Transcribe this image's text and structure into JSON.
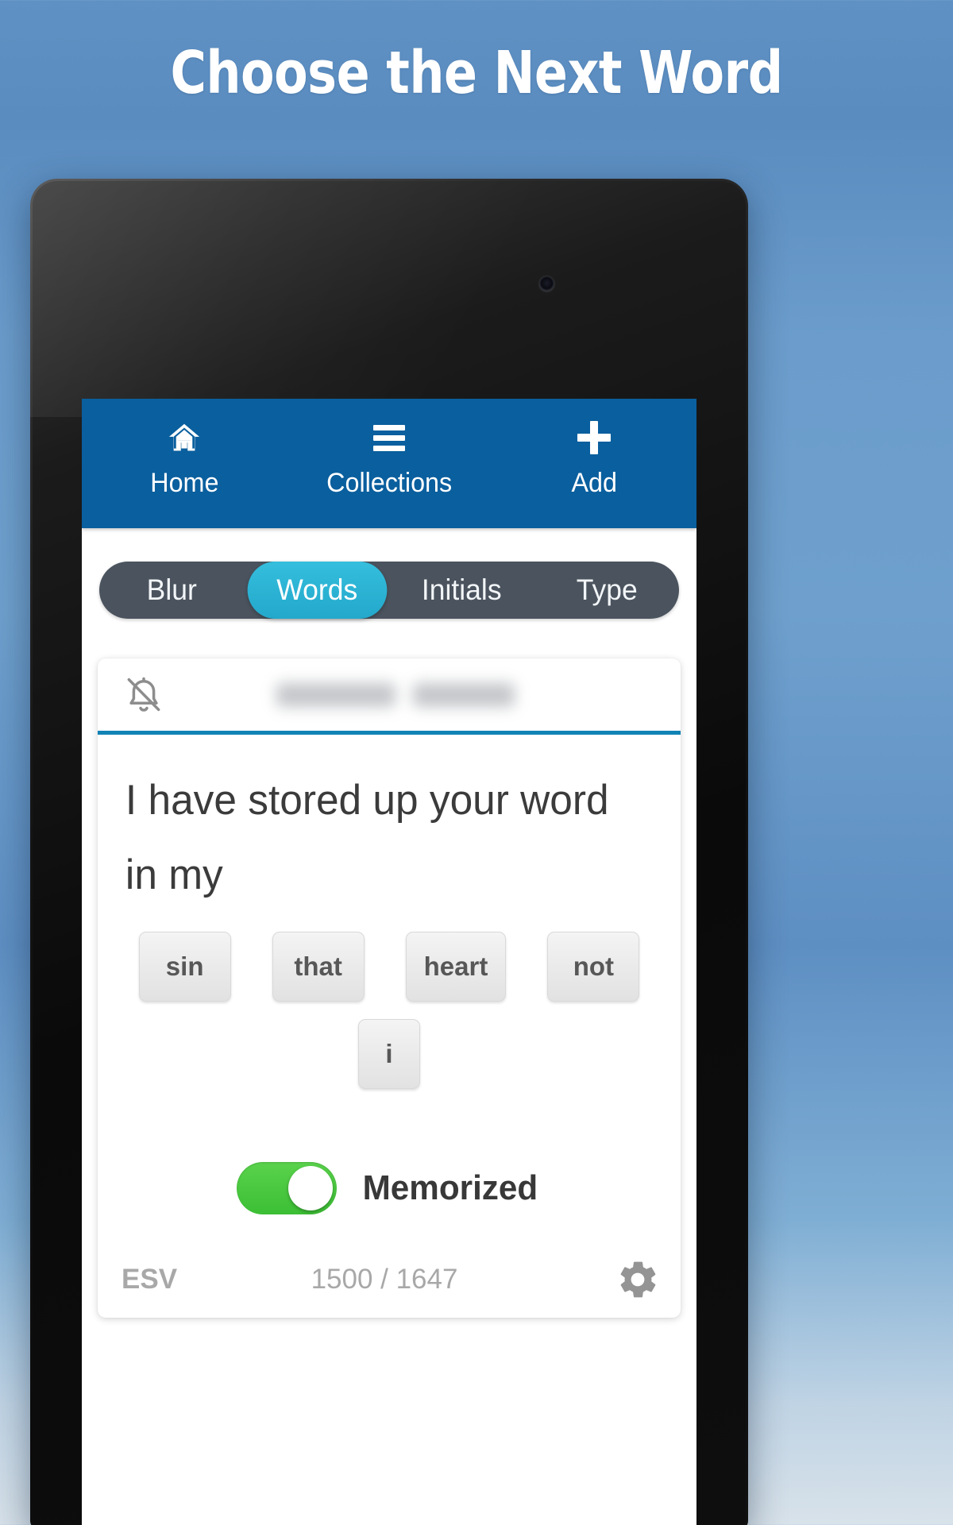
{
  "promo": {
    "headline": "Choose the Next Word"
  },
  "device": {
    "camera_icon": "front-camera-dot"
  },
  "nav": {
    "items": [
      {
        "label": "Home",
        "icon": "home-icon"
      },
      {
        "label": "Collections",
        "icon": "hamburger-menu-icon"
      },
      {
        "label": "Add",
        "icon": "plus-icon"
      }
    ]
  },
  "modes": {
    "options": [
      {
        "label": "Blur",
        "active": false
      },
      {
        "label": "Words",
        "active": true
      },
      {
        "label": "Initials",
        "active": false
      },
      {
        "label": "Type",
        "active": false
      }
    ]
  },
  "card": {
    "mute_icon": "bell-off-icon",
    "reference_blurred": true,
    "verse_text": "I have stored up your word in my",
    "choices": [
      {
        "label": "sin"
      },
      {
        "label": "that"
      },
      {
        "label": "heart"
      },
      {
        "label": "not"
      },
      {
        "label": "i"
      }
    ],
    "memorized": {
      "label": "Memorized",
      "on": true,
      "on_color": "#44c63c"
    },
    "footer": {
      "translation": "ESV",
      "counter": "1500 / 1647",
      "settings_icon": "gear-icon"
    }
  },
  "colors": {
    "nav_blue": "#0a5f9e",
    "accent_cyan": "#29b6d8",
    "segment_bg": "#4a535e",
    "divider_blue": "#1183b5",
    "toggle_green": "#44c63c"
  }
}
